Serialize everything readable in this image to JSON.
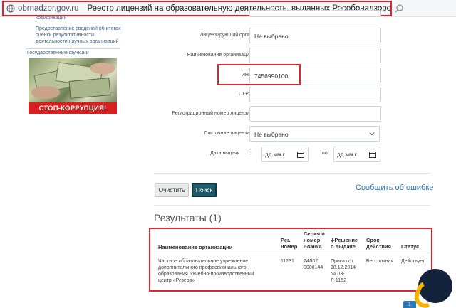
{
  "browser": {
    "domain": "obrnadzor.gov.ru",
    "title": "Реестр лицензий на образовательную деятельность, выданных Рособрнадзором | Св..."
  },
  "sidebar": {
    "fragment": "кодификации",
    "link": "Предоставление сведений об итогах оценки результативности деятельности научных организаций",
    "gov_functions": "Государственные функции",
    "banner_text": "СТОП-КОРРУПЦИЯ!"
  },
  "form": {
    "licensing_body": {
      "label": "Лицензирующий орган",
      "value": "Не выбрано"
    },
    "org_name": {
      "label": "Наименование организации",
      "value": ""
    },
    "inn": {
      "label": "ИНН",
      "value": "7456990100"
    },
    "ogrn": {
      "label": "ОГРН",
      "value": ""
    },
    "reg_number": {
      "label": "Регистрационный номер лицензии",
      "value": ""
    },
    "license_state": {
      "label": "Состояние лицензии",
      "value": "Не выбрано"
    },
    "issue_date": {
      "label": "Дата выдачи",
      "from_label": "с",
      "to_label": "по",
      "from_placeholder": "дд.мм.г",
      "to_placeholder": "дд.мм.г"
    }
  },
  "buttons": {
    "clear": "Очистить",
    "search": "Поиск",
    "report_error": "Сообщить об ошибке"
  },
  "results": {
    "title": "Результаты (1)",
    "headers": {
      "org_name": "Наименование организации",
      "reg_num_1": "Рег.",
      "reg_num_2": "номер",
      "series_1": "Серия и",
      "series_2": "номер",
      "series_3": "бланка",
      "decision_1": "🡫Решение",
      "decision_2": "о выдаче",
      "term_1": "Срок",
      "term_2": "действия",
      "status": "Статус"
    },
    "row": {
      "org_line1": "Частное образовательное учреждение",
      "org_line2": "дополнительного профессионального",
      "org_line3": "образования «Учебно-производственный",
      "org_line4": "центр «Резерв»",
      "reg_num": "11231",
      "series_1": "74Л02",
      "series_2": "0000144",
      "decision_1": "Приказ от",
      "decision_2": "18.12.2014",
      "decision_3": "№ 03-",
      "decision_4": "Л-1152",
      "term": "Бессрочная",
      "status": "Действует"
    }
  },
  "pagination": {
    "current": "1"
  },
  "colors": {
    "highlight": "#d9262c",
    "search_button": "#1d5a6b",
    "link": "#2b78b8",
    "banner_red": "#d81e1e"
  }
}
